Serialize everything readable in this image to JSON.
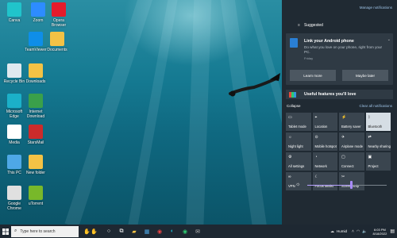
{
  "desktop_icons": [
    {
      "label": "Canva",
      "color": "#20c4cb"
    },
    {
      "label": "Zoom",
      "color": "#2d8cff"
    },
    {
      "label": "Opera Browser",
      "color": "#e41b2c"
    },
    {
      "label": "TeamViewer",
      "color": "#0e8ee9"
    },
    {
      "label": "Documents",
      "color": "#f3c245"
    },
    {
      "label": "Recycle Bin",
      "color": "#dfe9ef"
    },
    {
      "label": "Downloads",
      "color": "#f3c245"
    },
    {
      "label": "Microsoft Edge",
      "color": "#1bb0c8"
    },
    {
      "label": "Internet Download",
      "color": "#3aa04a"
    },
    {
      "label": "Media",
      "color": "#ffffff"
    },
    {
      "label": "StarsMail",
      "color": "#cc2b2b"
    },
    {
      "label": "This PC",
      "color": "#4ea8e6"
    },
    {
      "label": "New folder",
      "color": "#f3c245"
    },
    {
      "label": "Google Chrome",
      "color": "#e0e0e0"
    },
    {
      "label": "uTorrent",
      "color": "#78b82a"
    }
  ],
  "action_center": {
    "manage_label": "Manage notifications",
    "suggested_label": "Suggested",
    "notification": {
      "title": "Link your Android phone",
      "body": "Do what you love on your phone, right from your PC.",
      "day": "Friday",
      "learn_more": "Learn more",
      "maybe_later": "Maybe later"
    },
    "teaser_title": "Useful features you'll love",
    "collapse_label": "Collapse",
    "clear_label": "Clear all notifications",
    "tiles": [
      {
        "label": "Tablet mode",
        "icon": "▭",
        "on": false
      },
      {
        "label": "Location",
        "icon": "⌖",
        "on": false
      },
      {
        "label": "Battery saver",
        "icon": "⚡",
        "on": false
      },
      {
        "label": "Bluetooth",
        "icon": "ᛒ",
        "on": true
      },
      {
        "label": "Night light",
        "icon": "☼",
        "on": false
      },
      {
        "label": "Mobile hotspot",
        "icon": "⊙",
        "on": false
      },
      {
        "label": "Airplane mode",
        "icon": "✈",
        "on": false
      },
      {
        "label": "Nearby sharing",
        "icon": "⇄",
        "on": false
      },
      {
        "label": "All settings",
        "icon": "⚙",
        "on": false
      },
      {
        "label": "Network",
        "icon": "◔",
        "on": false
      },
      {
        "label": "Connect",
        "icon": "▢",
        "on": false
      },
      {
        "label": "Project",
        "icon": "▣",
        "on": false
      },
      {
        "label": "VPN",
        "icon": "∞",
        "on": false
      },
      {
        "label": "Focus assist",
        "icon": "☾",
        "on": false
      },
      {
        "label": "Screen snip",
        "icon": "✂",
        "on": false
      }
    ],
    "brightness_level": 0.55,
    "accent": "#a98cff"
  },
  "taskbar": {
    "search_placeholder": "Type here to search",
    "weather": "Humid",
    "time": "6:03 PM",
    "date": "8/18/2022",
    "apps": [
      "task-view",
      "file-explorer",
      "microsoft-store",
      "chrome",
      "edge",
      "chrome-alt",
      "mail"
    ]
  }
}
